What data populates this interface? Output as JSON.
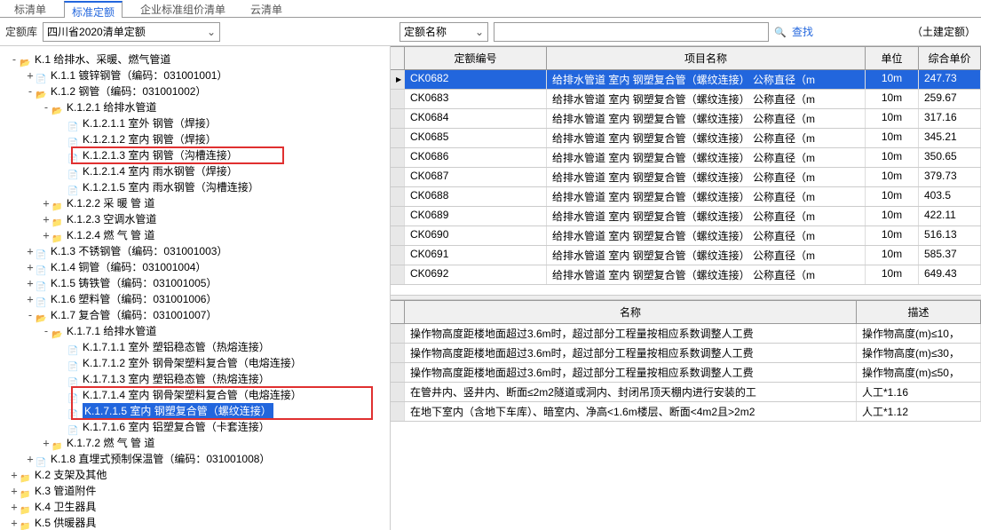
{
  "tabs": [
    "标清单",
    "标准定额",
    "企业标准组价清单",
    "云清单"
  ],
  "toolbar": {
    "lib_label": "定额库",
    "lib_value": "四川省2020清单定额",
    "filter_value": "定额名称",
    "find": "查找",
    "mode": "（土建定额）"
  },
  "tree": [
    {
      "d": 0,
      "i": "open",
      "t": "K.1 给排水、采暖、燃气管道",
      "e": "-"
    },
    {
      "d": 1,
      "i": "file",
      "t": "K.1.1 镀锌钢管（编码：031001001）",
      "e": "+"
    },
    {
      "d": 1,
      "i": "open",
      "t": "K.1.2 钢管（编码：031001002）",
      "e": "-"
    },
    {
      "d": 2,
      "i": "open",
      "t": "K.1.2.1 给排水管道",
      "e": "-"
    },
    {
      "d": 3,
      "i": "file",
      "t": "K.1.2.1.1 室外 钢管（焊接）",
      "e": ""
    },
    {
      "d": 3,
      "i": "file",
      "t": "K.1.2.1.2 室内 钢管（焊接）",
      "e": ""
    },
    {
      "d": 3,
      "i": "file",
      "t": "K.1.2.1.3 室内 钢管（沟槽连接）",
      "e": ""
    },
    {
      "d": 3,
      "i": "file",
      "t": "K.1.2.1.4 室内 雨水钢管（焊接）",
      "e": ""
    },
    {
      "d": 3,
      "i": "file",
      "t": "K.1.2.1.5 室内 雨水钢管（沟槽连接）",
      "e": ""
    },
    {
      "d": 2,
      "i": "closed",
      "t": "K.1.2.2 采 暖 管 道",
      "e": "+"
    },
    {
      "d": 2,
      "i": "closed",
      "t": "K.1.2.3 空调水管道",
      "e": "+"
    },
    {
      "d": 2,
      "i": "closed",
      "t": "K.1.2.4 燃 气 管 道",
      "e": "+"
    },
    {
      "d": 1,
      "i": "file",
      "t": "K.1.3 不锈钢管（编码：031001003）",
      "e": "+"
    },
    {
      "d": 1,
      "i": "file",
      "t": "K.1.4 铜管（编码：031001004）",
      "e": "+"
    },
    {
      "d": 1,
      "i": "file",
      "t": "K.1.5 铸铁管（编码：031001005）",
      "e": "+"
    },
    {
      "d": 1,
      "i": "file",
      "t": "K.1.6 塑料管（编码：031001006）",
      "e": "+"
    },
    {
      "d": 1,
      "i": "open",
      "t": "K.1.7 复合管（编码：031001007）",
      "e": "-"
    },
    {
      "d": 2,
      "i": "open",
      "t": "K.1.7.1 给排水管道",
      "e": "-"
    },
    {
      "d": 3,
      "i": "file",
      "t": "K.1.7.1.1 室外 塑铝稳态管（热熔连接）",
      "e": ""
    },
    {
      "d": 3,
      "i": "file",
      "t": "K.1.7.1.2 室外 钢骨架塑料复合管（电熔连接）",
      "e": ""
    },
    {
      "d": 3,
      "i": "file",
      "t": "K.1.7.1.3 室内 塑铝稳态管（热熔连接）",
      "e": ""
    },
    {
      "d": 3,
      "i": "file",
      "t": "K.1.7.1.4 室内 钢骨架塑料复合管（电熔连接）",
      "e": ""
    },
    {
      "d": 3,
      "i": "file",
      "t": "K.1.7.1.5 室内 钢塑复合管（螺纹连接）",
      "e": "",
      "sel": true
    },
    {
      "d": 3,
      "i": "file",
      "t": "K.1.7.1.6 室内 铝塑复合管（卡套连接）",
      "e": ""
    },
    {
      "d": 2,
      "i": "closed",
      "t": "K.1.7.2 燃 气 管 道",
      "e": "+"
    },
    {
      "d": 1,
      "i": "file",
      "t": "K.1.8 直埋式预制保温管（编码：031001008）",
      "e": "+"
    },
    {
      "d": 0,
      "i": "closed",
      "t": "K.2 支架及其他",
      "e": "+"
    },
    {
      "d": 0,
      "i": "closed",
      "t": "K.3 管道附件",
      "e": "+"
    },
    {
      "d": 0,
      "i": "closed",
      "t": "K.4 卫生器具",
      "e": "+"
    },
    {
      "d": 0,
      "i": "closed",
      "t": "K.5 供暖器具",
      "e": "+"
    }
  ],
  "grid": {
    "headers": [
      "定额编号",
      "项目名称",
      "单位",
      "综合单价"
    ],
    "rows": [
      {
        "code": "CK0682",
        "name": "给排水管道 室内 钢塑复合管（螺纹连接） 公称直径（m",
        "unit": "10m",
        "price": "247.73",
        "sel": true
      },
      {
        "code": "CK0683",
        "name": "给排水管道 室内 钢塑复合管（螺纹连接） 公称直径（m",
        "unit": "10m",
        "price": "259.67"
      },
      {
        "code": "CK0684",
        "name": "给排水管道 室内 钢塑复合管（螺纹连接） 公称直径（m",
        "unit": "10m",
        "price": "317.16"
      },
      {
        "code": "CK0685",
        "name": "给排水管道 室内 钢塑复合管（螺纹连接） 公称直径（m",
        "unit": "10m",
        "price": "345.21"
      },
      {
        "code": "CK0686",
        "name": "给排水管道 室内 钢塑复合管（螺纹连接） 公称直径（m",
        "unit": "10m",
        "price": "350.65"
      },
      {
        "code": "CK0687",
        "name": "给排水管道 室内 钢塑复合管（螺纹连接） 公称直径（m",
        "unit": "10m",
        "price": "379.73"
      },
      {
        "code": "CK0688",
        "name": "给排水管道 室内 钢塑复合管（螺纹连接） 公称直径（m",
        "unit": "10m",
        "price": "403.5"
      },
      {
        "code": "CK0689",
        "name": "给排水管道 室内 钢塑复合管（螺纹连接） 公称直径（m",
        "unit": "10m",
        "price": "422.11"
      },
      {
        "code": "CK0690",
        "name": "给排水管道 室内 钢塑复合管（螺纹连接） 公称直径（m",
        "unit": "10m",
        "price": "516.13"
      },
      {
        "code": "CK0691",
        "name": "给排水管道 室内 钢塑复合管（螺纹连接） 公称直径（m",
        "unit": "10m",
        "price": "585.37"
      },
      {
        "code": "CK0692",
        "name": "给排水管道 室内 钢塑复合管（螺纹连接） 公称直径（m",
        "unit": "10m",
        "price": "649.43"
      }
    ]
  },
  "detail": {
    "headers": [
      "名称",
      "描述"
    ],
    "rows": [
      {
        "a": "操作物高度距楼地面超过3.6m时，超过部分工程量按相应系数调整人工费",
        "b": "操作物高度(m)≤10，"
      },
      {
        "a": "操作物高度距楼地面超过3.6m时，超过部分工程量按相应系数调整人工费",
        "b": "操作物高度(m)≤30，"
      },
      {
        "a": "操作物高度距楼地面超过3.6m时，超过部分工程量按相应系数调整人工费",
        "b": "操作物高度(m)≤50，"
      },
      {
        "a": "在管井内、竖井内、断面≤2m2隧道或洞内、封闭吊顶天棚内进行安装的工",
        "b": "人工*1.16"
      },
      {
        "a": "在地下室内（含地下车库）、暗室内、净高<1.6m楼层、断面<4m2且>2m2",
        "b": "人工*1.12"
      }
    ]
  }
}
